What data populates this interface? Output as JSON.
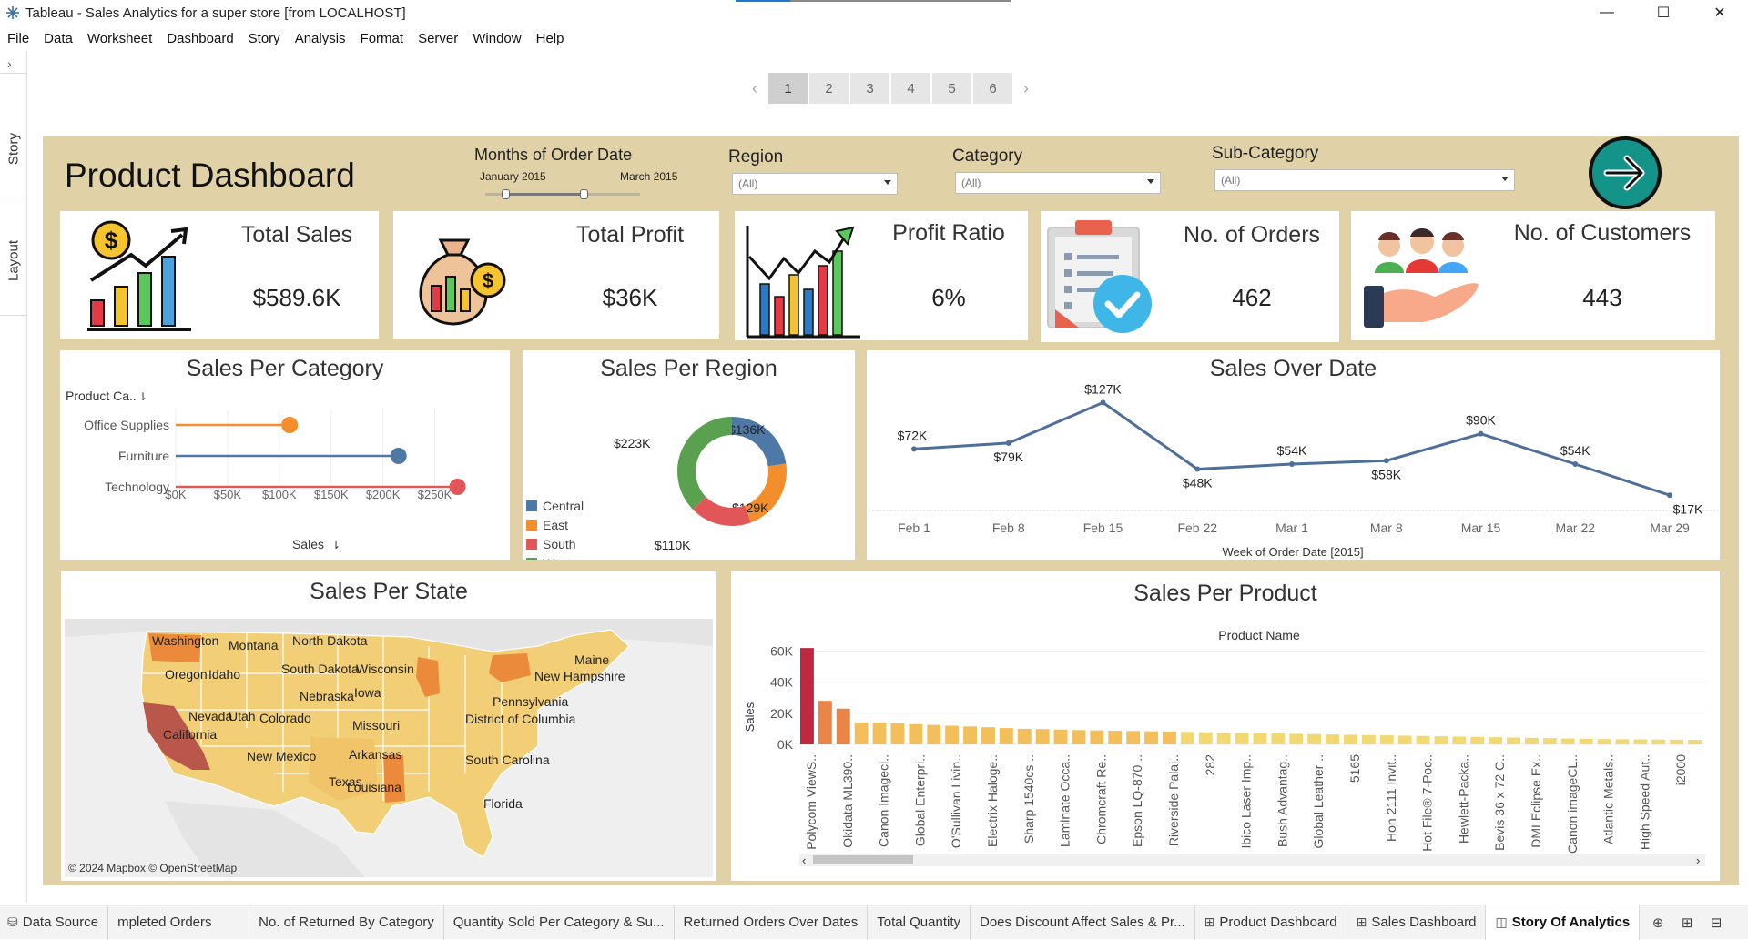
{
  "window": {
    "title": "Tableau - Sales Analytics for a super store [from LOCALHOST]",
    "controls": {
      "minimize": "—",
      "maximize": "☐",
      "close": "✕"
    }
  },
  "menu": [
    "File",
    "Data",
    "Worksheet",
    "Dashboard",
    "Story",
    "Analysis",
    "Format",
    "Server",
    "Window",
    "Help"
  ],
  "left_rail": {
    "expand": "›",
    "tabs": [
      "Story",
      "Layout"
    ]
  },
  "story_nav": {
    "prev": "‹",
    "next": "›",
    "pages": [
      "1",
      "2",
      "3",
      "4",
      "5",
      "6"
    ],
    "active_index": 0
  },
  "dashboard": {
    "title": "Product Dashboard",
    "filters": {
      "months": {
        "label": "Months of Order Date",
        "start": "January 2015",
        "end": "March 2015"
      },
      "region": {
        "label": "Region",
        "value": "(All)"
      },
      "category": {
        "label": "Category",
        "value": "(All)"
      },
      "subcategory": {
        "label": "Sub-Category",
        "value": "(All)"
      }
    },
    "next_button": "→",
    "kpis": {
      "total_sales": {
        "title": "Total Sales",
        "value": "$589.6K"
      },
      "total_profit": {
        "title": "Total Profit",
        "value": "$36K"
      },
      "profit_ratio": {
        "title": "Profit Ratio",
        "value": "6%"
      },
      "orders": {
        "title": "No. of Orders",
        "value": "462"
      },
      "customers": {
        "title": "No. of Customers",
        "value": "443"
      }
    },
    "sales_per_category": {
      "title": "Sales Per Category",
      "header": "Product Ca.."
    },
    "sales_per_region": {
      "title": "Sales Per Region"
    },
    "sales_over_date": {
      "title": "Sales Over Date"
    },
    "sales_per_state": {
      "title": "Sales Per State",
      "attribution": "© 2024 Mapbox © OpenStreetMap",
      "labels": [
        "Washington",
        "Montana",
        "North Dakota",
        "Oregon",
        "Idaho",
        "South Dakota",
        "Wisconsin",
        "Maine",
        "New Hampshire",
        "Nebraska",
        "Iowa",
        "Pennsylvania",
        "Nevada",
        "Utah",
        "Colorado",
        "District of Columbia",
        "Missouri",
        "California",
        "Arkansas",
        "New Mexico",
        "South Carolina",
        "Texas",
        "Louisiana",
        "Florida"
      ]
    },
    "sales_per_product": {
      "title": "Sales Per Product"
    }
  },
  "chart_data": [
    {
      "type": "bar",
      "orientation": "horizontal-lollipop",
      "title": "Sales Per Category",
      "categories": [
        "Office Supplies",
        "Furniture",
        "Technology"
      ],
      "values": [
        110000,
        215000,
        272000
      ],
      "xlabel": "Sales",
      "ylabel": "Product Ca..",
      "xlim": [
        0,
        275000
      ],
      "xticks": [
        "$0K",
        "$50K",
        "$100K",
        "$150K",
        "$200K",
        "$250K"
      ],
      "colors": [
        "#f28e2b",
        "#4e79a7",
        "#e15759"
      ]
    },
    {
      "type": "pie",
      "style": "donut",
      "title": "Sales Per Region",
      "categories": [
        "Central",
        "East",
        "South",
        "West"
      ],
      "values": [
        136000,
        129000,
        110000,
        223000
      ],
      "labels": [
        "$136K",
        "$129K",
        "$110K",
        "$223K"
      ],
      "colors": [
        "#4e79a7",
        "#f28e2b",
        "#e15759",
        "#59a14f"
      ],
      "legend": "left"
    },
    {
      "type": "line",
      "title": "Sales Over Date",
      "x": [
        "Feb 1",
        "Feb 8",
        "Feb 15",
        "Feb 22",
        "Mar 1",
        "Mar 8",
        "Mar 15",
        "Mar 22",
        "Mar 29"
      ],
      "values": [
        72,
        79,
        127,
        48,
        54,
        58,
        90,
        54,
        17
      ],
      "labels": [
        "$72K",
        "$79K",
        "$127K",
        "$48K",
        "$54K",
        "$58K",
        "$90K",
        "$54K",
        "$17K"
      ],
      "xlabel": "Week of Order Date [2015]",
      "ylim": [
        0,
        135
      ],
      "color": "#4e6f9a"
    },
    {
      "type": "bar",
      "title": "Sales Per Product",
      "header": "Product Name",
      "ylabel": "Sales",
      "ylim": [
        0,
        65000
      ],
      "yticks": [
        "0K",
        "20K",
        "40K",
        "60K"
      ],
      "values": [
        62000,
        28000,
        23000,
        14000,
        14000,
        13500,
        13000,
        12500,
        12000,
        11500,
        11000,
        10500,
        10000,
        9800,
        9500,
        9200,
        9000,
        8800,
        8600,
        8400,
        8200,
        8000,
        7800,
        7600,
        7400,
        7200,
        7000,
        6800,
        6600,
        6400,
        6200,
        6000,
        5800,
        5600,
        5400,
        5200,
        5000,
        4800,
        4600,
        4400,
        4200,
        4000,
        3800,
        3600,
        3400,
        3300,
        3200,
        3100,
        3000,
        2900
      ],
      "tick_labels": [
        "Polycom ViewS..",
        "Okidata ML390..",
        "Canon Imagecl..",
        "Global Enterpri..",
        "O'Sullivan Livin..",
        "Electrix Haloge..",
        "Sharp 1540cs ..",
        "Laminate Occa..",
        "Chromcraft Re..",
        "Epson LQ-870 ..",
        "Riverside Palai..",
        "282",
        "Ibico Laser Imp..",
        "Bush Advantag..",
        "Global Leather ..",
        "5165",
        "Hon 2111 Invit..",
        "Hot File® 7-Poc..",
        "Hewlett-Packa..",
        "Bevis 36 x 72 C..",
        "DMI Eclipse Ex..",
        "Canon imageCL..",
        "Atlantic Metals..",
        "High Speed Aut..",
        "i2000"
      ],
      "colors": {
        "high": "#c0283f",
        "mid": "#ea8548",
        "low": "#f2bf5a",
        "lowest": "#f2d870"
      }
    }
  ],
  "tabs": [
    {
      "label": "Data Source",
      "icon": "⛁"
    },
    {
      "label": "mpleted Orders"
    },
    {
      "label": "No. of Returned By Category"
    },
    {
      "label": "Quantity Sold Per Category & Su..."
    },
    {
      "label": "Returned Orders Over Dates"
    },
    {
      "label": "Total Quantity"
    },
    {
      "label": "Does Discount Affect Sales & Pr..."
    },
    {
      "label": "Product Dashboard",
      "icon": "⊞"
    },
    {
      "label": "Sales Dashboard",
      "icon": "⊞"
    },
    {
      "label": "Story Of Analytics",
      "icon": "◫",
      "active": true
    }
  ],
  "tab_tail_icons": [
    "⊕",
    "⊞",
    "⊟"
  ]
}
